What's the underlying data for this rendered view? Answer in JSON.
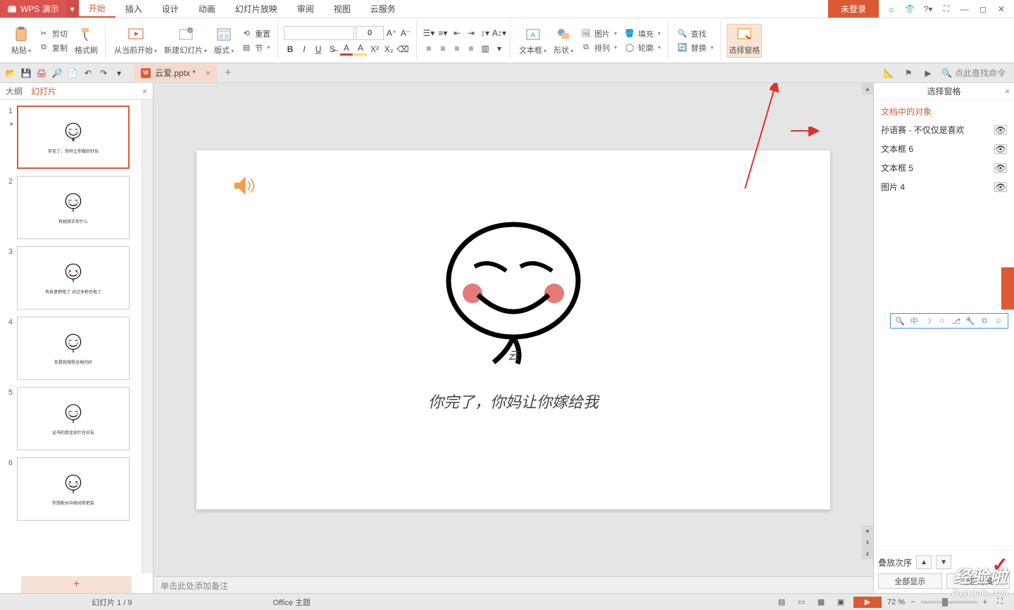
{
  "app": {
    "name": "WPS 演示",
    "login": "未登录"
  },
  "tabs": [
    "开始",
    "插入",
    "设计",
    "动画",
    "幻灯片放映",
    "审阅",
    "视图",
    "云服务"
  ],
  "active_tab": 0,
  "file": {
    "name": "云爱.pptx *"
  },
  "quick_right": {
    "search_placeholder": "点此查找命令"
  },
  "ribbon": {
    "paste": "粘贴",
    "cut": "剪切",
    "copy": "复制",
    "format_painter": "格式刷",
    "from_current": "从当前开始",
    "new_slide": "新建幻灯片",
    "layout": "版式",
    "reset": "重置",
    "section": "节",
    "textbox": "文本框",
    "shape": "形状",
    "arrange": "排列",
    "picture": "图片",
    "fill": "填充",
    "outline": "轮廓",
    "find": "查找",
    "replace": "替换",
    "selection_pane": "选择窗格"
  },
  "left": {
    "tabs": [
      "大纲",
      "幻灯片"
    ],
    "active": 1
  },
  "thumbs": [
    {
      "num": "1",
      "caption": "你见了，你时让你做好好玩"
    },
    {
      "num": "2",
      "caption": "有她其实你什么"
    },
    {
      "num": "3",
      "caption": "有执意把电了  对过多称也电了"
    },
    {
      "num": "4",
      "caption": "你是我想我坐地问好"
    },
    {
      "num": "5",
      "caption": "证书的我坐如什在好友"
    },
    {
      "num": "6",
      "caption": "你想能长中她对前把会"
    }
  ],
  "slide": {
    "yun": "云",
    "text": "你完了，你妈让你嫁给我"
  },
  "notes_placeholder": "单击此处添加备注",
  "selection_pane": {
    "title": "选择窗格",
    "section": "文档中的对象",
    "items": [
      "孙语赛 - 不仅仅是喜欢",
      "文本框 6",
      "文本框 5",
      "图片 4"
    ],
    "stack_label": "叠放次序",
    "show_all": "全部显示",
    "hide_all": "全部隐藏"
  },
  "status": {
    "slide": "幻灯片 1 / 9",
    "theme": "Office 主题",
    "zoom": "72 %"
  },
  "watermark": {
    "main": "经验啦",
    "sub": "jingyanla.com"
  }
}
